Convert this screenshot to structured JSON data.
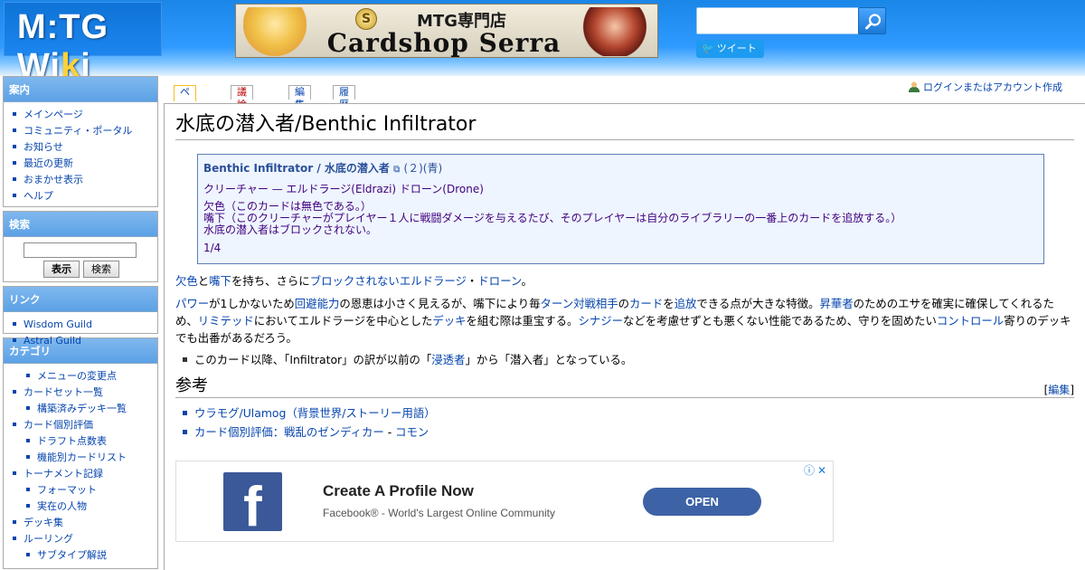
{
  "header": {
    "logo_prefix": "M:TG Wi",
    "logo_hl": "k",
    "logo_suffix": "i",
    "banner": {
      "subtitle": "MTG専門店",
      "title": "Cardshop Serra",
      "coin": "S"
    },
    "search_placeholder": "",
    "tweet_label": "ツイート"
  },
  "sidebar": {
    "nav": {
      "title": "案内",
      "items": [
        "メインページ",
        "コミュニティ・ポータル",
        "お知らせ",
        "最近の更新",
        "おまかせ表示",
        "ヘルプ"
      ]
    },
    "search": {
      "title": "検索",
      "go_label": "表示",
      "search_label": "検索"
    },
    "links": {
      "title": "リンク",
      "items": [
        "Wisdom Guild",
        "Astral Guild"
      ]
    },
    "categories": {
      "title": "カテゴリ",
      "items": [
        "メニューの変更点",
        "カードセット一覧",
        "構築済みデッキ一覧",
        "カード個別評価",
        "ドラフト点数表",
        "機能別カードリスト",
        "トーナメント記録",
        "フォーマット",
        "実在の人物",
        "デッキ集",
        "ルーリング",
        "サブタイプ解説"
      ]
    }
  },
  "tabs": {
    "page": "ページ",
    "talk": "議論",
    "edit": "編集",
    "history": "履歴"
  },
  "usermenu": {
    "login": "ログインまたはアカウント作成"
  },
  "article": {
    "title": "水底の潜入者/Benthic Infiltrator",
    "card": {
      "name": "Benthic Infiltrator / 水底の潜入者",
      "ext_icon": "⧉",
      "cost": "(２)(青)",
      "type": "クリーチャー — エルドラージ(Eldrazi) ドローン(Drone)",
      "text": [
        "欠色（このカードは無色である。）",
        "嘴下（このクリーチャーがプレイヤー１人に戦闘ダメージを与えるたび、そのプレイヤーは自分のライブラリーの一番上のカードを追放する。）",
        "水底の潜入者はブロックされない。"
      ],
      "pt": "1/4"
    },
    "p1": {
      "t1": "欠色",
      "t2": "と",
      "t3": "嘴下",
      "t4": "を持ち、さらに",
      "t5": "ブロックされない",
      "t6": "エルドラージ",
      "t7": "・",
      "t8": "ドローン",
      "t9": "。"
    },
    "p2": {
      "t1": "パワー",
      "t2": "が1しかないため",
      "t3": "回避能力",
      "t4": "の恩恵は小さく見えるが、嘴下により毎",
      "t5": "ターン",
      "t6": "対戦相手",
      "t7": "の",
      "t8": "カード",
      "t9": "を",
      "t10": "追放",
      "t11": "できる点が大きな特徴。",
      "t12": "昇華者",
      "t13": "のためのエサを確実に確保してくれるため、",
      "t14": "リミテッド",
      "t15": "においてエルドラージを中心とした",
      "t16": "デッキ",
      "t17": "を組む際は重宝する。",
      "t18": "シナジー",
      "t19": "などを考慮せずとも悪くない性能であるため、守りを固めたい",
      "t20": "コントロール",
      "t21": "寄りのデッキでも出番があるだろう。"
    },
    "note": {
      "t1": "このカード以降、「Infiltrator」の訳が以前の「",
      "t2": "浸透者",
      "t3": "」から「潜入者」となっている。"
    },
    "refs": {
      "heading": "参考",
      "edit_open": "[",
      "edit_label": "編集",
      "edit_close": "]",
      "item1_link": "ウラモグ/Ulamog",
      "item1_rest": "（背景世界/ストーリー用語）",
      "item2_link": "カード個別評価：戦乱のゼンディカー",
      "item2_sep": " - ",
      "item2_link2": "コモン"
    }
  },
  "ad": {
    "logo": "f",
    "title": "Create A Profile Now",
    "desc": "Facebook® - World's Largest Online Community",
    "button": "OPEN",
    "choices": "ⓘ✕"
  }
}
